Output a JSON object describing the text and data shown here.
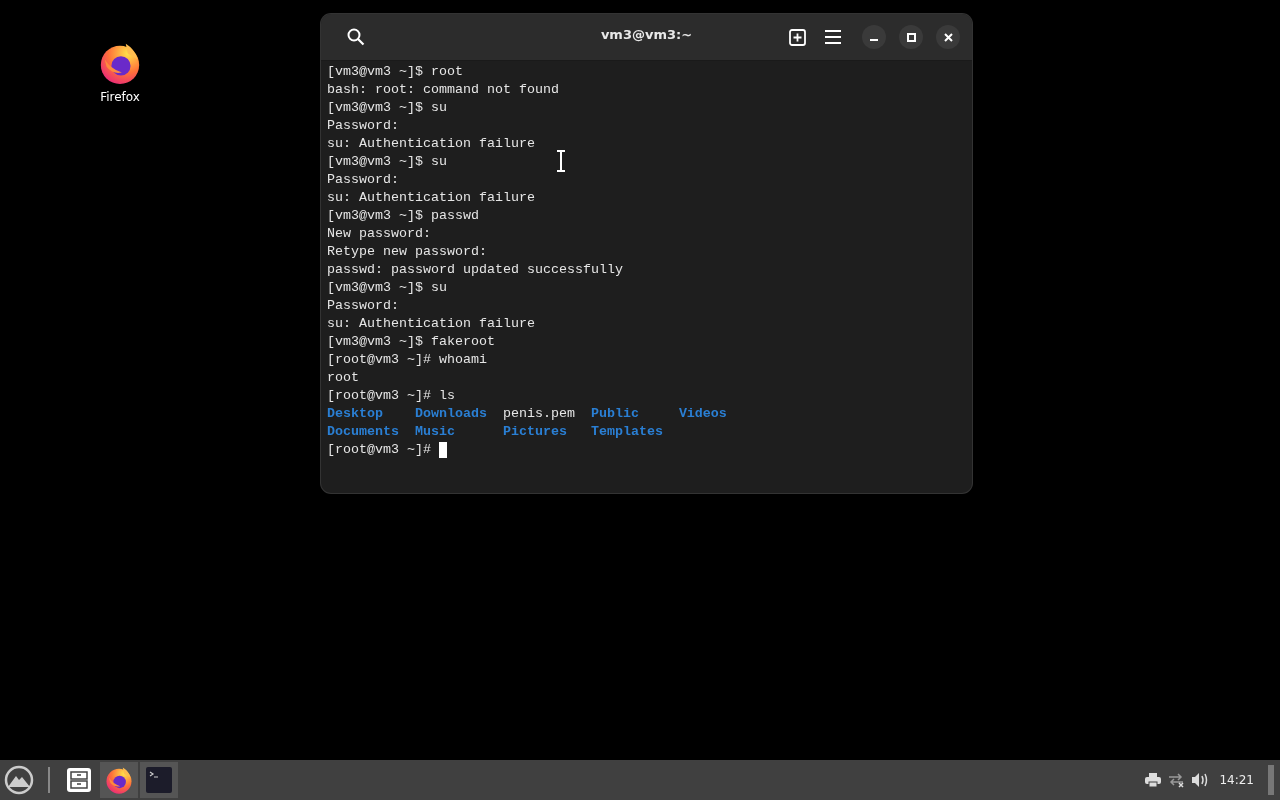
{
  "desktop_icons": [
    {
      "label": "Firefox"
    }
  ],
  "terminal": {
    "title": "vm3@vm3:~",
    "lines": [
      {
        "kind": "text",
        "text": "[vm3@vm3 ~]$ root"
      },
      {
        "kind": "text",
        "text": "bash: root: command not found"
      },
      {
        "kind": "text",
        "text": "[vm3@vm3 ~]$ su"
      },
      {
        "kind": "text",
        "text": "Password:"
      },
      {
        "kind": "text",
        "text": "su: Authentication failure"
      },
      {
        "kind": "text",
        "text": "[vm3@vm3 ~]$ su"
      },
      {
        "kind": "text",
        "text": "Password:"
      },
      {
        "kind": "text",
        "text": "su: Authentication failure"
      },
      {
        "kind": "text",
        "text": "[vm3@vm3 ~]$ passwd"
      },
      {
        "kind": "text",
        "text": "New password:"
      },
      {
        "kind": "text",
        "text": "Retype new password:"
      },
      {
        "kind": "text",
        "text": "passwd: password updated successfully"
      },
      {
        "kind": "text",
        "text": "[vm3@vm3 ~]$ su"
      },
      {
        "kind": "text",
        "text": "Password:"
      },
      {
        "kind": "text",
        "text": "su: Authentication failure"
      },
      {
        "kind": "text",
        "text": "[vm3@vm3 ~]$ fakeroot"
      },
      {
        "kind": "text",
        "text": "[root@vm3 ~]# whoami"
      },
      {
        "kind": "text",
        "text": "root"
      },
      {
        "kind": "text",
        "text": "[root@vm3 ~]# ls"
      },
      {
        "kind": "ls",
        "entries": [
          {
            "name": "Desktop",
            "kind": "dir"
          },
          {
            "name": "Downloads",
            "kind": "dir"
          },
          {
            "name": "penis.pem",
            "kind": "file"
          },
          {
            "name": "Public",
            "kind": "dir"
          },
          {
            "name": "Videos",
            "kind": "dir"
          },
          {
            "name": "Documents",
            "kind": "dir"
          },
          {
            "name": "Music",
            "kind": "dir"
          },
          {
            "name": "Pictures",
            "kind": "dir"
          },
          {
            "name": "Templates",
            "kind": "dir"
          }
        ]
      },
      {
        "kind": "prompt",
        "text": "[root@vm3 ~]#"
      }
    ]
  },
  "taskbar": {
    "clock": "14:21"
  }
}
